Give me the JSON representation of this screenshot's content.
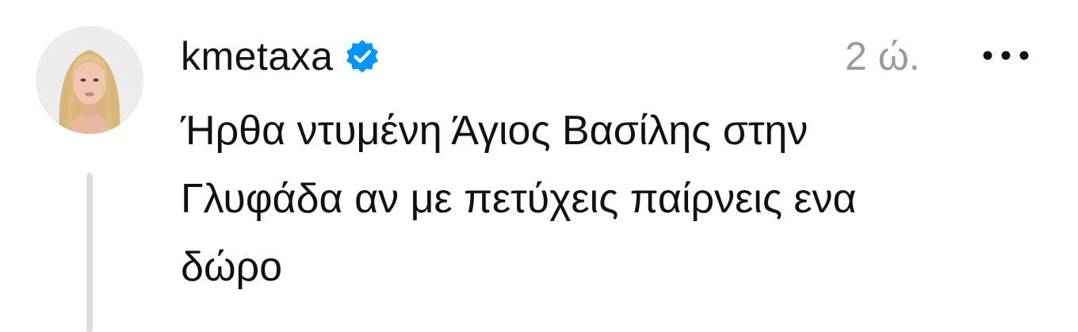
{
  "post": {
    "username": "kmetaxa",
    "verified": true,
    "timestamp": "2 ώ.",
    "text_lines": [
      "Ήρθα ντυμένη Άγιος Βασίλης στην",
      "Γλυφάδα αν με πετύχεις παίρνεις ενα",
      "δώρο"
    ]
  },
  "icons": {
    "verified": "verified-badge-icon",
    "more": "more-horizontal-icon"
  },
  "colors": {
    "verified_badge": "#0095f6",
    "timestamp": "#9b9b9b",
    "thread_line": "#dcdcdc"
  }
}
